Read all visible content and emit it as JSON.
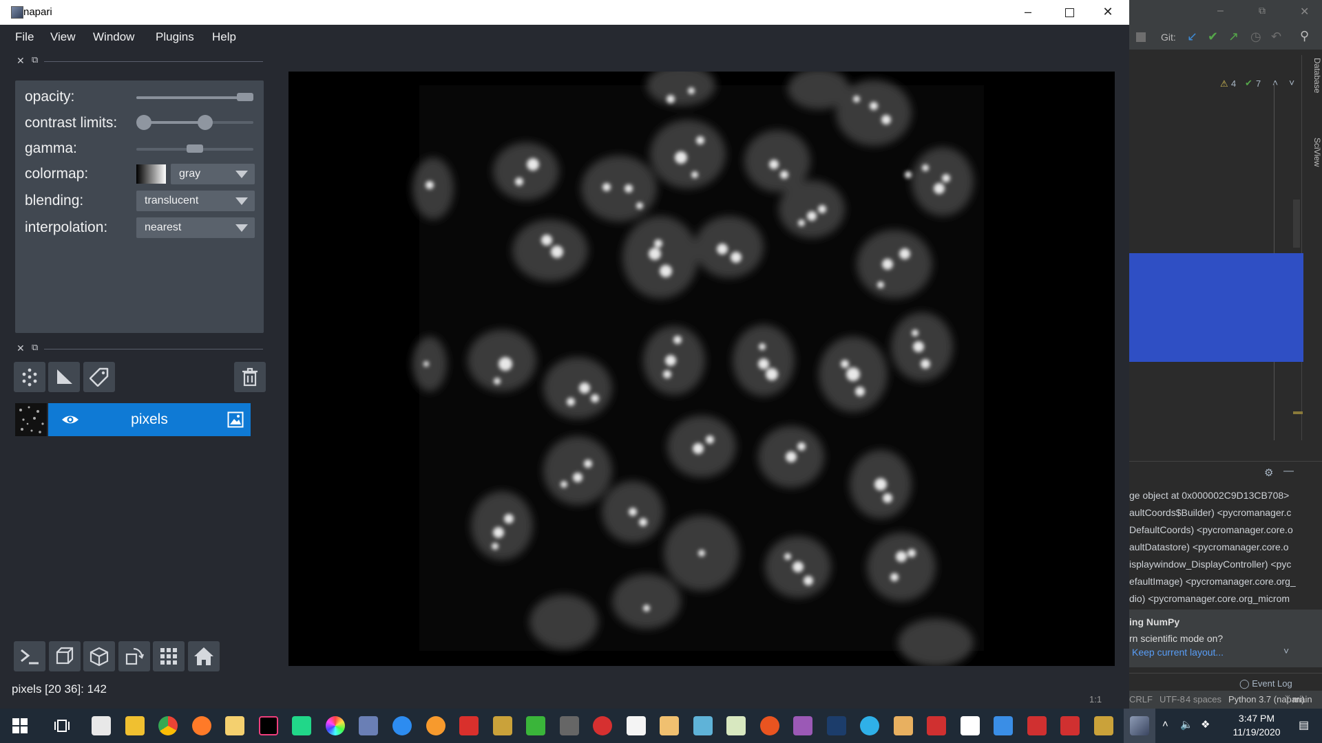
{
  "window": {
    "title": "napari"
  },
  "menu": [
    "File",
    "View",
    "Window",
    "Plugins",
    "Help"
  ],
  "controls": {
    "opacity": {
      "label": "opacity:",
      "value": 1.0
    },
    "contrast_limits": {
      "label": "contrast limits:",
      "low": 0.0,
      "high": 0.6
    },
    "gamma": {
      "label": "gamma:",
      "value": 0.5
    },
    "colormap": {
      "label": "colormap:",
      "value": "gray"
    },
    "blending": {
      "label": "blending:",
      "value": "translucent"
    },
    "interpolation": {
      "label": "interpolation:",
      "value": "nearest"
    }
  },
  "layer": {
    "name": "pixels"
  },
  "status": "pixels [20 36]: 142",
  "ide": {
    "git_label": "Git:",
    "warnings": "4",
    "checks": "7",
    "side_tabs": [
      "Database",
      "SciView"
    ],
    "console_lines": [
      "ge object at 0x000002C9D13CB708>",
      "aultCoords$Builder) <pycromanager.c",
      "DefaultCoords) <pycromanager.core.o",
      "aultDatastore) <pycromanager.core.o",
      "isplaywindow_DisplayController) <pyc",
      "efaultImage) <pycromanager.core.org_",
      "dio) <pycromanager.core.org_microm"
    ],
    "notice_title": "ing NumPy",
    "notice_text": "rn scientific mode on?",
    "notice_link": "Keep current layout...",
    "event_log": "Event Log",
    "statusbar": [
      "1:1",
      "CRLF",
      "UTF-8",
      "4 spaces",
      "Python 3.7 (napari)",
      "main"
    ]
  },
  "taskbar": {
    "time": "3:47 PM",
    "date": "11/19/2020"
  },
  "colors": {
    "accent": "#0f7ad5",
    "panel": "#414851",
    "window_bg": "#262930",
    "ide_selection": "#2f4fc4"
  }
}
